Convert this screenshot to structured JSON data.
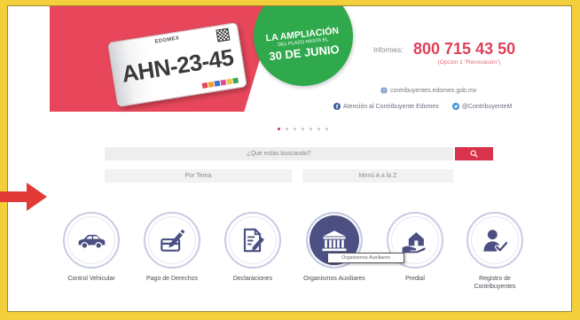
{
  "colors": {
    "frame": "#f3cf3b",
    "banner_red": "#e8475b",
    "badge_green": "#2fa94c",
    "accent_red": "#d8334a",
    "navy": "#4b4f82",
    "arrow_red": "#e23b37"
  },
  "banner": {
    "plate": {
      "brand": "EDOMEX",
      "number": "AHN-23-45"
    },
    "badge": {
      "line1": "LA AMPLIACIÓN",
      "line2": "DEL PLAZO HASTA EL",
      "line3": "30 DE JUNIO"
    }
  },
  "contact": {
    "informes_label": "Informes:",
    "phone": "800 715 43 50",
    "option": "(Opción 1 “Renovación”)",
    "website": "contribuyentes.edomex.gob.mx",
    "facebook": "Atención al Contribuyente Edomex",
    "twitter": "@ContribuyenteM",
    "icons": {
      "website": "globe-icon",
      "facebook": "facebook-icon",
      "twitter": "twitter-icon"
    }
  },
  "carousel": {
    "slide_count": 7,
    "active_slide": 1
  },
  "search": {
    "placeholder": "¿Qué estás buscando?",
    "button_icon": "search-icon"
  },
  "filters": {
    "by_topic": "Por Tema",
    "a_to_z": "Menú A a la Z"
  },
  "services": [
    {
      "label": "Control Vehicular",
      "icon": "car-icon",
      "highlighted": false
    },
    {
      "label": "Pago de Derechos",
      "icon": "payment-icon",
      "highlighted": false
    },
    {
      "label": "Declaraciones",
      "icon": "declaration-icon",
      "highlighted": false
    },
    {
      "label": "Organismos Auxiliares",
      "icon": "building-icon",
      "highlighted": true
    },
    {
      "label": "Predial",
      "icon": "house-hand-icon",
      "highlighted": false
    },
    {
      "label": "Registro de Contribuyentes",
      "icon": "taxpayer-icon",
      "highlighted": false
    }
  ],
  "tooltip": "Organismos Auxiliares",
  "annotation": {
    "icon": "red-arrow-icon"
  }
}
